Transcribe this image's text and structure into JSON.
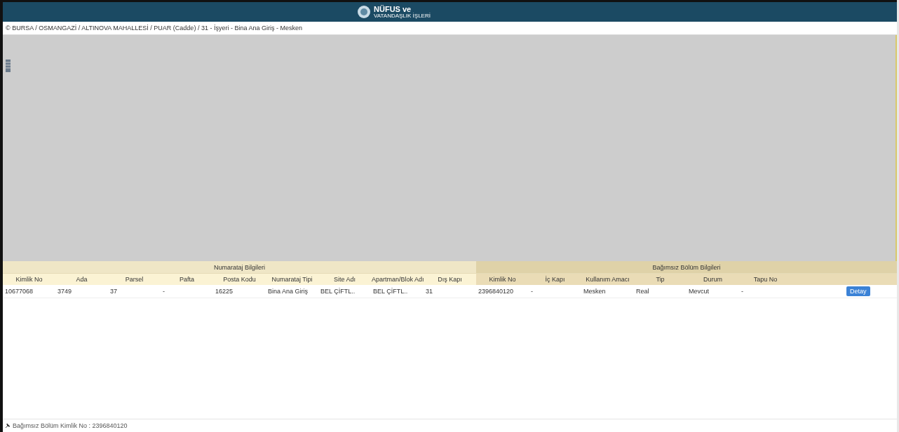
{
  "header": {
    "logo_title": "NÜFUS ve",
    "logo_subtitle": "VATANDAŞLIK İŞLERİ"
  },
  "breadcrumb": "© BURSA / OSMANGAZİ / ALTINOVA MAHALLESİ / PUAR (Cadde) / 31 - İşyeri - Bina Ana Giriş - Mesken",
  "table": {
    "groups": [
      {
        "label": "Numarataj Bilgileri",
        "kind": "numarataj"
      },
      {
        "label": "Bağımsız Bölüm Bilgileri",
        "kind": "bolum"
      }
    ],
    "columns": [
      {
        "label": "Kimlik No",
        "kind": "numarataj"
      },
      {
        "label": "Ada",
        "kind": "numarataj"
      },
      {
        "label": "Parsel",
        "kind": "numarataj"
      },
      {
        "label": "Pafta",
        "kind": "numarataj"
      },
      {
        "label": "Posta Kodu",
        "kind": "numarataj"
      },
      {
        "label": "Numarataj Tipi",
        "kind": "numarataj"
      },
      {
        "label": "Site Adı",
        "kind": "numarataj"
      },
      {
        "label": "Apartman/Blok Adı",
        "kind": "numarataj"
      },
      {
        "label": "Dış Kapı",
        "kind": "numarataj"
      },
      {
        "label": "Kimlik No",
        "kind": "bolum"
      },
      {
        "label": "İç Kapı",
        "kind": "bolum"
      },
      {
        "label": "Kullanım Amacı",
        "kind": "bolum"
      },
      {
        "label": "Tip",
        "kind": "bolum"
      },
      {
        "label": "Durum",
        "kind": "bolum"
      },
      {
        "label": "Tapu No",
        "kind": "bolum"
      }
    ],
    "rows": [
      {
        "cells": [
          "10677068",
          "3749",
          "37",
          "-",
          "16225",
          "Bina Ana Giriş",
          "BEL ÇİFTL..",
          "BEL ÇİFTL..",
          "31",
          "2396840120",
          "-",
          "Mesken",
          "Real",
          "Mevcut",
          "-"
        ],
        "button": "Detay"
      }
    ]
  },
  "footer": "Bağımsız Bölüm Kimlik No : 2396840120"
}
